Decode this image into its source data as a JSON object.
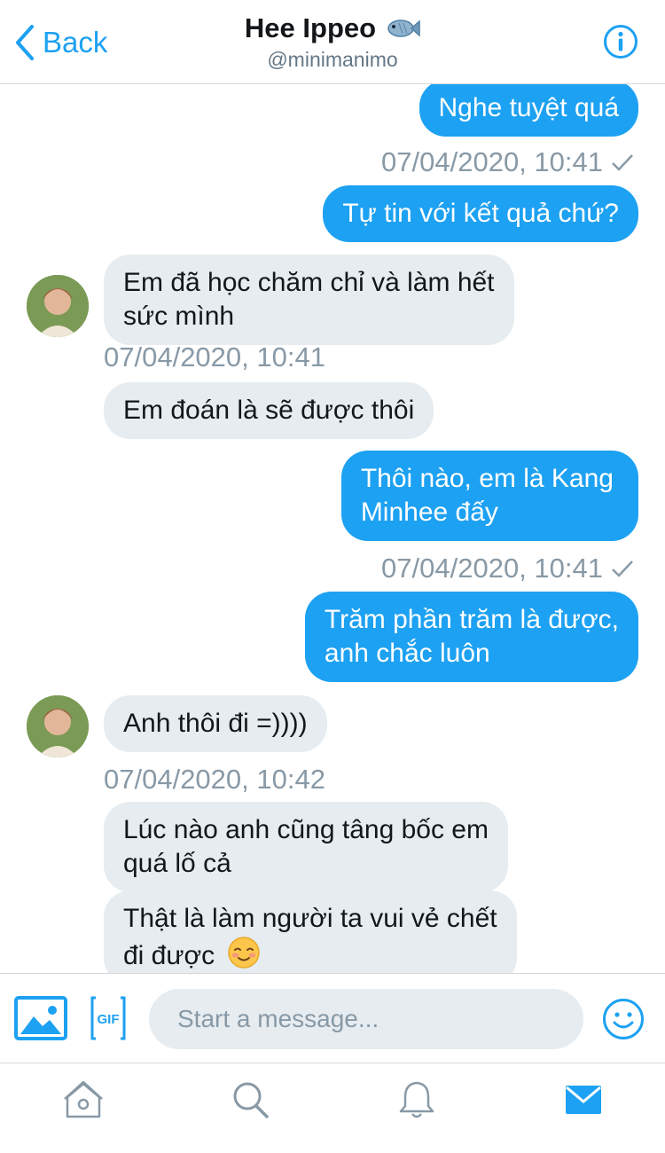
{
  "header": {
    "back_label": "Back",
    "title": "Hee Ippeo",
    "title_emoji_icon": "fish-icon",
    "handle": "@minimanimo",
    "info_icon": "info-icon"
  },
  "messages": [
    {
      "dir": "out",
      "lines": [
        "Nghe tuyệt quá"
      ]
    },
    {
      "stamp": "07/04/2020, 10:41",
      "dir": "out"
    },
    {
      "dir": "out",
      "lines": [
        "Tự tin với kết quả chứ?"
      ]
    },
    {
      "dir": "in",
      "lines": [
        "Em đã học chăm chỉ và làm hết",
        "sức mình"
      ]
    },
    {
      "stamp": "07/04/2020, 10:41",
      "dir": "in"
    },
    {
      "dir": "in",
      "lines": [
        "Em đoán là sẽ được thôi"
      ]
    },
    {
      "dir": "out",
      "lines": [
        "Thôi nào, em là Kang",
        "Minhee đấy"
      ]
    },
    {
      "stamp": "07/04/2020, 10:41",
      "dir": "out"
    },
    {
      "dir": "out",
      "lines": [
        "Trăm phần trăm là được,",
        "anh chắc luôn"
      ]
    },
    {
      "dir": "in",
      "lines": [
        "Anh thôi đi =))))"
      ]
    },
    {
      "stamp": "07/04/2020, 10:42",
      "dir": "in"
    },
    {
      "dir": "in",
      "lines": [
        "Lúc nào anh cũng tâng bốc em",
        "quá lố cả"
      ]
    },
    {
      "dir": "in",
      "lines": [
        "Thật là làm người ta vui vẻ chết",
        "đi được"
      ],
      "emoji": "smiling-blush-emoji"
    }
  ],
  "composer": {
    "placeholder": "Start a message...",
    "gif_label": "GIF"
  },
  "tabs": [
    "home-icon",
    "search-icon",
    "bell-icon",
    "mail-icon"
  ],
  "colors": {
    "accent": "#1da1f2",
    "incoming_bubble": "#e6ecf0",
    "timestamp": "#8899a6"
  }
}
